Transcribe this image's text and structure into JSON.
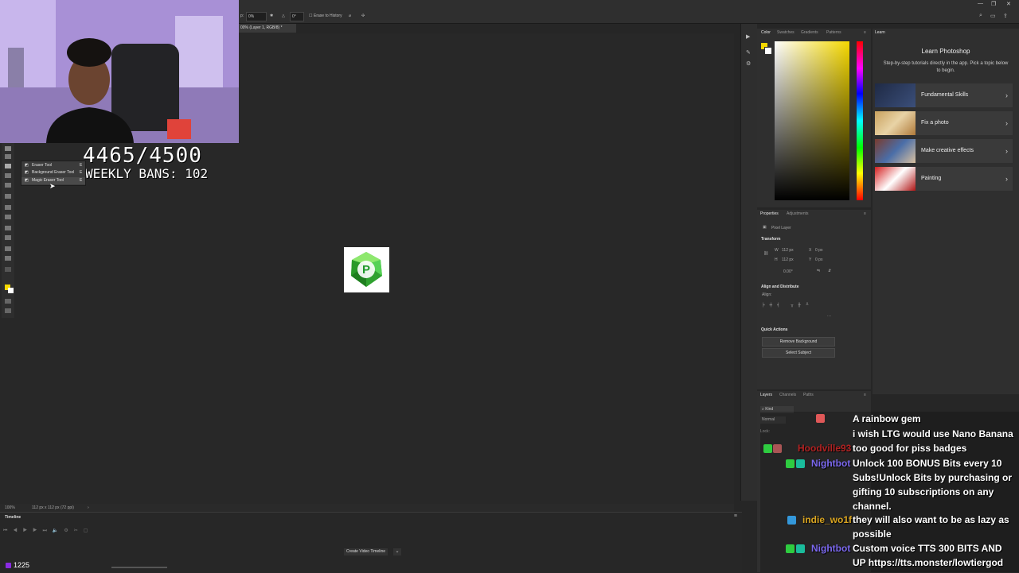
{
  "options_bar": {
    "opacity_label": "p:",
    "opacity_value": "0%",
    "flow_value": "0°",
    "erase_to_history": "Erase to History"
  },
  "document_tab": {
    "title": "00% (Layer 1, RGB/8) *"
  },
  "stream_overlay": {
    "progress": "4465/4500",
    "weekly_bans": "WEEKLY BANS: 102",
    "viewer_count": "1225"
  },
  "tool_flyout": {
    "items": [
      {
        "label": "Eraser Tool",
        "key": "E"
      },
      {
        "label": "Background Eraser Tool",
        "key": "E"
      },
      {
        "label": "Magic Eraser Tool",
        "key": "E"
      }
    ]
  },
  "status_bar": {
    "zoom": "100%",
    "doc_size": "112 px x 112 px (72 ppi)"
  },
  "timeline": {
    "tab": "Timeline",
    "create_button": "Create Video Timeline"
  },
  "color_panel": {
    "tabs": [
      "Color",
      "Swatches",
      "Gradients",
      "Patterns"
    ],
    "foreground_color": "#f5d800"
  },
  "learn_panel": {
    "tab": "Learn",
    "title": "Learn Photoshop",
    "subtitle": "Step-by-step tutorials directly in the app. Pick a topic below to begin.",
    "items": [
      {
        "label": "Fundamental Skills"
      },
      {
        "label": "Fix a photo"
      },
      {
        "label": "Make creative effects"
      },
      {
        "label": "Painting"
      }
    ]
  },
  "properties_panel": {
    "tabs": [
      "Properties",
      "Adjustments"
    ],
    "layer_type": "Pixel Layer",
    "transform_title": "Transform",
    "w_label": "W",
    "w_value": "112 px",
    "h_label": "H",
    "h_value": "112 px",
    "x_label": "X",
    "x_value": "0 px",
    "y_label": "Y",
    "y_value": "0 px",
    "angle_value": "0.00°",
    "align_title": "Align and Distribute",
    "align_label": "Align:",
    "quick_actions_title": "Quick Actions",
    "remove_bg": "Remove Background",
    "select_subject": "Select Subject"
  },
  "layers_panel": {
    "tabs": [
      "Layers",
      "Channels",
      "Paths"
    ],
    "filter": "Kind",
    "blend_mode": "Normal",
    "lock_label": "Lock:"
  },
  "chat": {
    "messages": [
      {
        "user": "",
        "text": "A rainbow gem",
        "user_color": "#ff4444"
      },
      {
        "user": "",
        "text": "i wish LTG would use Nano Banana",
        "user_color": "#8a2be2"
      },
      {
        "user": "Hoodville93",
        "text": "too good for piss badges",
        "user_color": "#b22222"
      },
      {
        "user": "Nightbot",
        "text": "Unlock 100 BONUS Bits every 10 Subs!Unlock Bits by purchasing or gifting 10 subscriptions on any channel.",
        "user_color": "#7b68ee"
      },
      {
        "user": "indie_wo1f",
        "text": "they will also want to be as lazy as possible",
        "user_color": "#daa520"
      },
      {
        "user": "Nightbot",
        "text": "Custom voice TTS 300 BITS AND UP https://tts.monster/lowtiergod",
        "user_color": "#7b68ee"
      }
    ]
  }
}
